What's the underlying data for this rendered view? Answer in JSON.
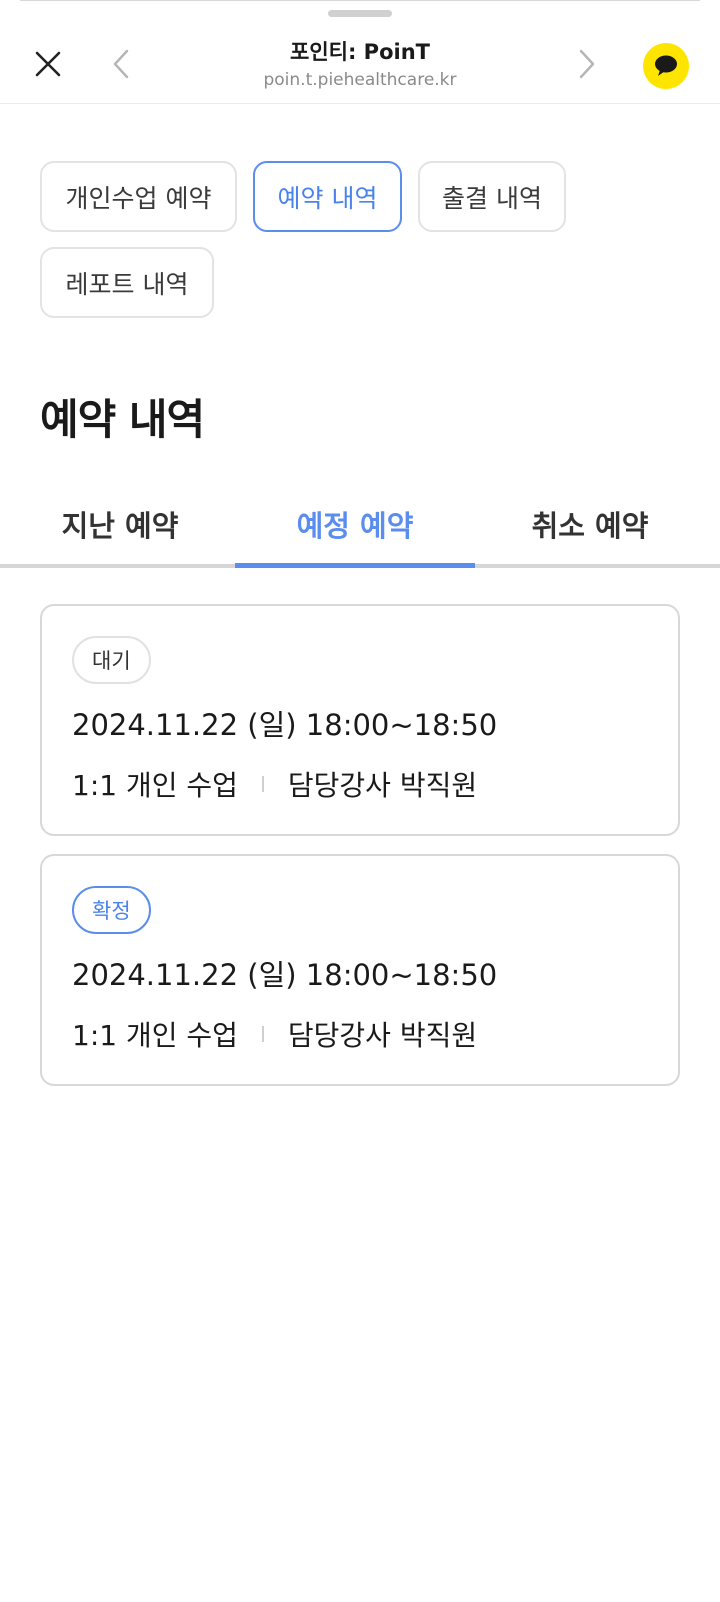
{
  "browser": {
    "title": "포인티: PoinT",
    "url": "poin.t.piehealthcare.kr",
    "accent": "#fee500"
  },
  "menu": {
    "chips": [
      {
        "label": "개인수업 예약",
        "active": false
      },
      {
        "label": "예약 내역",
        "active": true
      },
      {
        "label": "출결 내역",
        "active": false
      },
      {
        "label": "레포트 내역",
        "active": false
      }
    ]
  },
  "page": {
    "title": "예약 내역"
  },
  "tabs": [
    {
      "label": "지난 예약",
      "active": false
    },
    {
      "label": "예정 예약",
      "active": true
    },
    {
      "label": "취소 예약",
      "active": false
    }
  ],
  "reservations": [
    {
      "status": "대기",
      "datetime": "2024.11.22 (일) 18:00~18:50",
      "lesson": "1:1 개인 수업",
      "instructor": "담당강사 박직원"
    },
    {
      "status": "확정",
      "datetime": "2024.11.22 (일) 18:00~18:50",
      "lesson": "1:1 개인 수업",
      "instructor": "담당강사 박직원"
    }
  ],
  "colors": {
    "accent_blue": "#5b8def",
    "kakao_yellow": "#fee500"
  }
}
